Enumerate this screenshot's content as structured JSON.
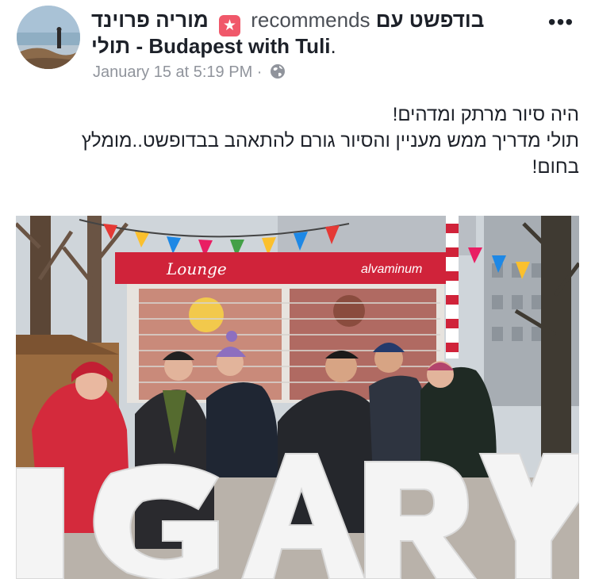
{
  "post": {
    "author": "מוריה פרוינד",
    "verb": "recommends",
    "page_part1": "בודפשט עם",
    "page_part2": "תולי - Budapest with Tuli",
    "period": ".",
    "timestamp": "January 15 at 5:19 PM",
    "separator": "·",
    "privacy_icon": "globe-icon",
    "badge_icon": "star-icon",
    "more_icon": "more-options-icon",
    "text_lines": [
      "היה סיור מרתק ומדהים!",
      "תולי מדריך ממש מעניין והסיור גורם להתאהב בבדופשט..מומלץ",
      "בחום!"
    ]
  },
  "photo": {
    "sign_letters": "NGARY",
    "kiosk_sign_left": "Lounge",
    "kiosk_sign_right": "alvaminum"
  },
  "colors": {
    "badge": "#f0586a",
    "meta": "#90949c",
    "kiosk_red": "#d0233a"
  }
}
